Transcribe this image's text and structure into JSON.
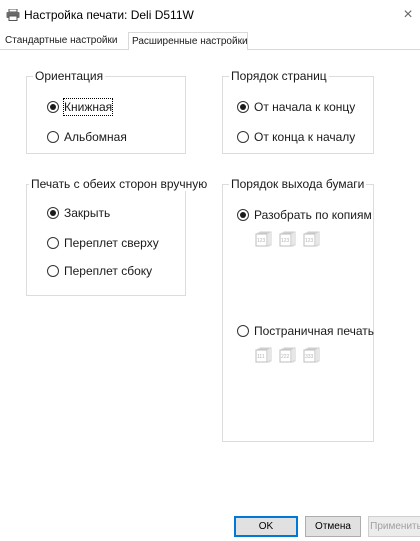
{
  "window": {
    "title": "Настройка печати: Deli D511W",
    "close_glyph": "×",
    "icon": "printer-icon"
  },
  "tabs": [
    {
      "label": "Стандартные настройки",
      "active": false
    },
    {
      "label": "Расширенные настройки",
      "active": true
    }
  ],
  "orientation": {
    "title": "Ориентация",
    "options": [
      {
        "label": "Книжная",
        "selected": true
      },
      {
        "label": "Альбомная",
        "selected": false
      }
    ]
  },
  "page_order": {
    "title": "Порядок страниц",
    "options": [
      {
        "label": "От начала к концу",
        "selected": true
      },
      {
        "label": "От конца к началу",
        "selected": false
      }
    ]
  },
  "duplex": {
    "title": "Печать с обеих сторон вручную",
    "options": [
      {
        "label": "Закрыть",
        "selected": true
      },
      {
        "label": "Переплет сверху",
        "selected": false
      },
      {
        "label": "Переплет сбоку",
        "selected": false
      }
    ]
  },
  "output_order": {
    "title": "Порядок выхода бумаги",
    "options": [
      {
        "label": "Разобрать по копиям",
        "selected": true,
        "icons": [
          "123",
          "123",
          "123"
        ]
      },
      {
        "label": "Постраничная печать",
        "selected": false,
        "icons": [
          "111",
          "222",
          "333"
        ]
      }
    ]
  },
  "buttons": {
    "ok": "OK",
    "cancel": "Отмена",
    "apply": "Применить"
  },
  "colors": {
    "accent": "#0078d7",
    "border": "#dcdcdc",
    "disabled_text": "#a0a0a0"
  }
}
